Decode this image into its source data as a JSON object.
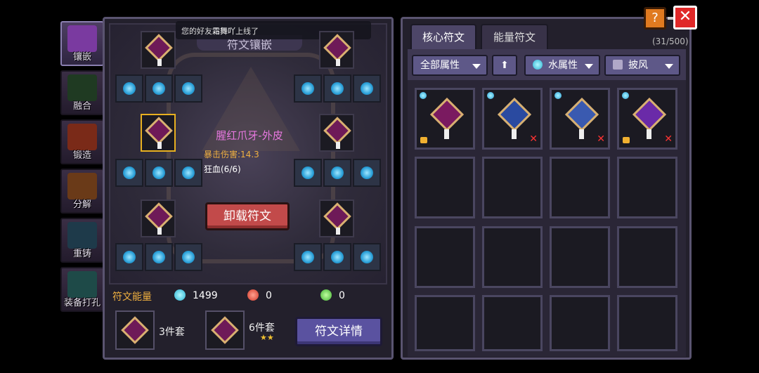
{
  "sidebar": {
    "items": [
      {
        "label": "镶嵌",
        "color": "#c070e0"
      },
      {
        "label": "融合",
        "color": "#3a8a3a"
      },
      {
        "label": "锻造",
        "color": "#c04020"
      },
      {
        "label": "分解",
        "color": "#d0a020"
      },
      {
        "label": "重铸",
        "color": "#40a060"
      },
      {
        "label": "装备打孔",
        "color": "#2a9a8a"
      }
    ]
  },
  "notice": {
    "prefix": "您的好友",
    "name": "霜舞吖",
    "suffix": "上线了"
  },
  "left": {
    "banner": "符文镶嵌",
    "tooltip": {
      "title": "腥红爪牙-外皮",
      "line1": "暴击伤害:14.3",
      "line2": "狂血(6/6)"
    },
    "unload_button": "卸载符文",
    "energy": {
      "title": "符文能量",
      "values": [
        "1499",
        "0",
        "0"
      ]
    },
    "sets": [
      {
        "label": "3件套"
      },
      {
        "label": "6件套",
        "stars": "★★"
      }
    ],
    "detail_button": "符文详情"
  },
  "right": {
    "tabs": [
      "核心符文",
      "能量符文"
    ],
    "count": "(31/500)",
    "filters": {
      "all_attr": "全部属性",
      "sort_icon": "arrow-up-icon",
      "element": "水属性",
      "slot": "披风"
    },
    "runes": [
      {
        "color": "#7a1a60",
        "locked": true,
        "remove": false
      },
      {
        "color": "#2a4aa0",
        "locked": false,
        "remove": true
      },
      {
        "color": "#3a5ab0",
        "locked": false,
        "remove": true
      },
      {
        "color": "#6a2aa8",
        "locked": true,
        "remove": true
      }
    ]
  },
  "buttons": {
    "help": "?",
    "close": "✕"
  }
}
